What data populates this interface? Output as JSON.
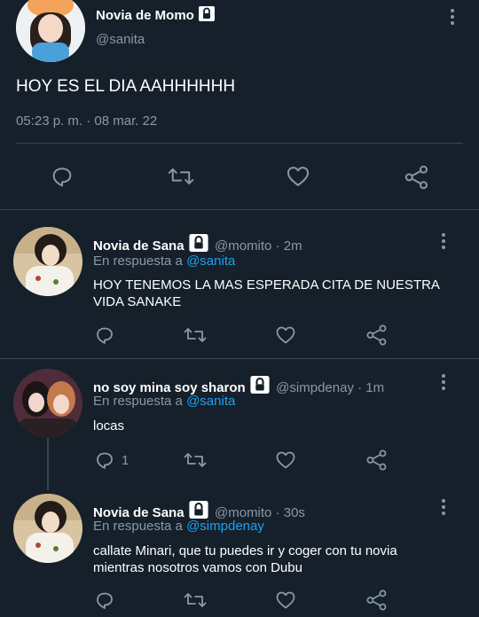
{
  "main_tweet": {
    "name": "Novia de Momo",
    "handle": "@sanita",
    "text": "HOY ES EL DIA AAHHHHHH",
    "timestamp": "05:23 p. m. · 08 mar. 22"
  },
  "replies": [
    {
      "name": "Novia de Sana",
      "handle": "@momito · 2m",
      "reply_prefix": "En respuesta a",
      "reply_to": "@sanita",
      "text_line1": "HOY TENEMOS LA MAS ESPERADA CITA DE NUESTRA",
      "text_line2": "VIDA SANAKE"
    },
    {
      "name": "no soy mina soy sharon",
      "handle": "@simpdenay · 1m",
      "reply_prefix": "En respuesta a",
      "reply_to": "@sanita",
      "text_line1": "locas",
      "reply_count": "1"
    },
    {
      "name": "Novia de Sana",
      "handle": "@momito · 30s",
      "reply_prefix": "En respuesta a",
      "reply_to": "@simpdenay",
      "text_line1": "callate Minari, que tu puedes ir y coger con tu novia",
      "text_line2": "mientras nosotros vamos con Dubu"
    }
  ],
  "icons": [
    "reply-icon",
    "retweet-icon",
    "like-icon",
    "share-icon",
    "lock-icon",
    "more-icon"
  ],
  "colors": {
    "background": "#15202b",
    "muted": "#8899a6",
    "link": "#1da1f2",
    "divider": "#38444d"
  }
}
